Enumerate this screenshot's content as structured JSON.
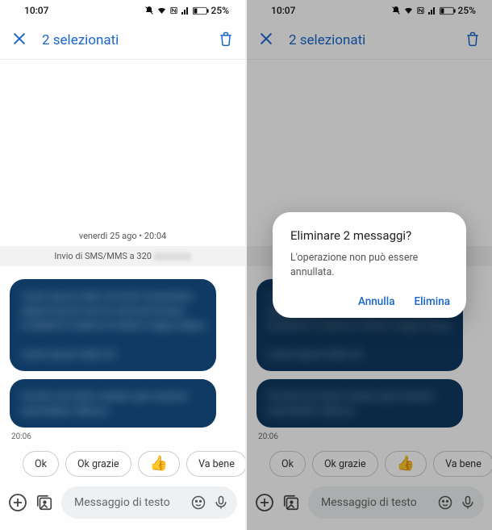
{
  "status": {
    "time": "10:07",
    "battery_text": "25%"
  },
  "topbar": {
    "title": "2 selezionati"
  },
  "chat": {
    "datestamp": "venerdì 25 ago • 20:04",
    "sms_line_prefix": "Invio di SMS/MMS a 320",
    "time_below": "20:06"
  },
  "suggestions": {
    "ok": "Ok",
    "ok_thanks": "Ok grazie",
    "thumbs": "👍",
    "va_bene": "Va bene"
  },
  "compose": {
    "placeholder": "Messaggio di testo"
  },
  "dialog": {
    "title": "Eliminare 2 messaggi?",
    "body": "L'operazione non può essere annullata.",
    "cancel": "Annulla",
    "confirm": "Elimina"
  }
}
